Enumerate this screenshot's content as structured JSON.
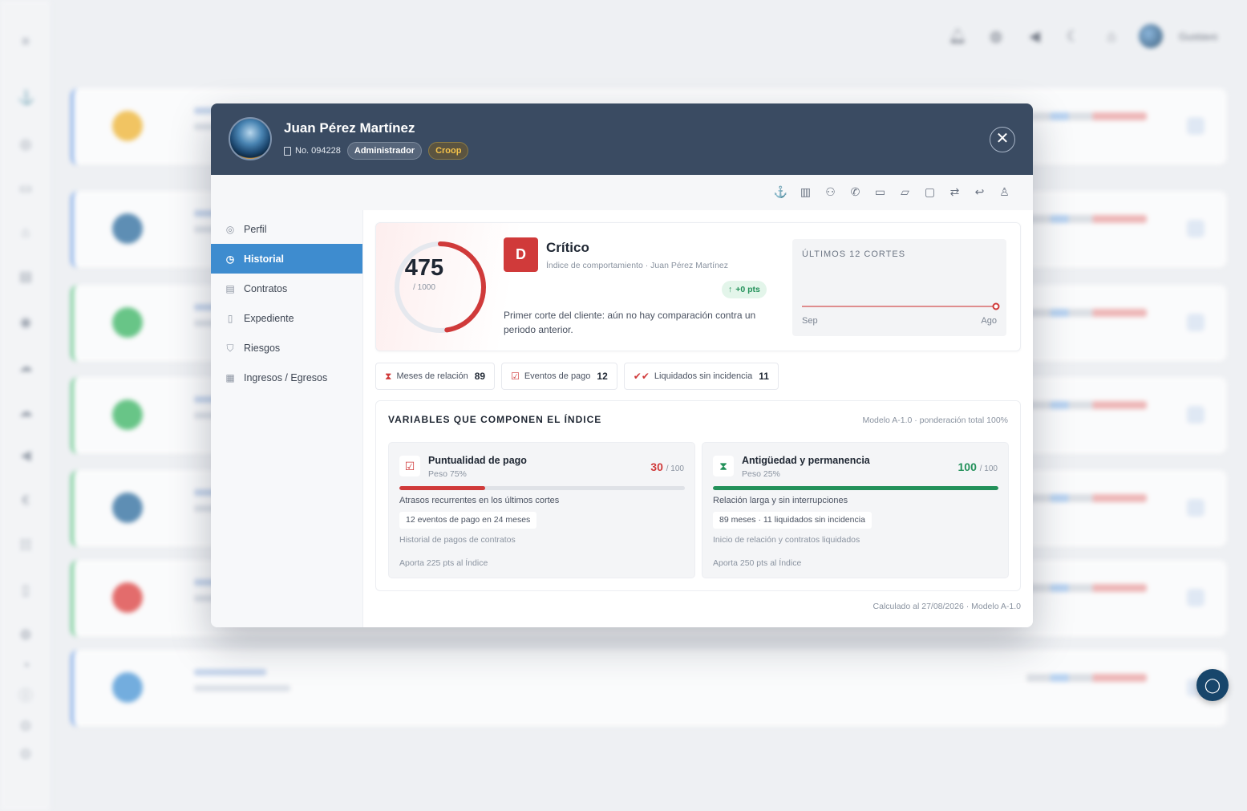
{
  "topbar": {
    "user_name": "Gustavo"
  },
  "modal": {
    "name": "Juan Pérez Martínez",
    "client_no": "No. 094228",
    "role_badge": "Administrador",
    "tier_badge": "Croop",
    "close_icon": "close-icon"
  },
  "toolbar": {
    "icons": [
      "stamp-icon",
      "barcode-icon",
      "user-icon",
      "phone-icon",
      "chat-icon",
      "note-icon",
      "wallet-icon",
      "transfer-icon",
      "reply-icon",
      "signature-icon"
    ]
  },
  "sidebar": {
    "items": [
      {
        "label": "Perfil",
        "icon": "user-circle-icon"
      },
      {
        "label": "Historial",
        "icon": "history-icon",
        "active": true
      },
      {
        "label": "Contratos",
        "icon": "document-icon"
      },
      {
        "label": "Expediente",
        "icon": "folder-icon"
      },
      {
        "label": "Riesgos",
        "icon": "shield-icon"
      },
      {
        "label": "Ingresos / Egresos",
        "icon": "cash-icon"
      }
    ]
  },
  "score": {
    "value": "475",
    "max_label": "/ 1000",
    "value_num": 475,
    "max_num": 1000,
    "grade": "D",
    "grade_label": "Crítico",
    "subtitle": "Índice de comportamiento · Juan Pérez Martínez",
    "delta": "+0 pts",
    "note": "Primer corte del cliente: aún no hay comparación contra un periodo anterior.",
    "accent_color": "#d03a3a"
  },
  "trend": {
    "title": "ÚLTIMOS 12 CORTES",
    "start_label": "Sep",
    "end_label": "Ago"
  },
  "chips": [
    {
      "label": "Meses de relación",
      "value": "89",
      "icon": "hourglass-icon"
    },
    {
      "label": "Eventos de pago",
      "value": "12",
      "icon": "calendar-check-icon"
    },
    {
      "label": "Liquidados sin incidencia",
      "value": "11",
      "icon": "double-check-icon"
    }
  ],
  "variables": {
    "title": "VARIABLES QUE COMPONEN EL ÍNDICE",
    "meta": "Modelo A-1.0 · ponderación total 100%",
    "items": [
      {
        "name": "Puntualidad de pago",
        "weight": "Peso 75%",
        "score": "30",
        "of": "/ 100",
        "fill_fraction": 0.3,
        "color": "#d03a3a",
        "description": "Atrasos recurrentes en los últimos cortes",
        "tag": "12 eventos de pago en 24 meses",
        "source": "Historial de pagos de contratos",
        "contribution": "Aporta 225 pts al Índice"
      },
      {
        "name": "Antigüedad y permanencia",
        "weight": "Peso 25%",
        "score": "100",
        "of": "/ 100",
        "fill_fraction": 1.0,
        "color": "#23915a",
        "description": "Relación larga y sin interrupciones",
        "tag": "89 meses · 11 liquidados sin incidencia",
        "source": "Inicio de relación y contratos liquidados",
        "contribution": "Aporta 250 pts al Índice"
      }
    ]
  },
  "footer": "Calculado al 27/08/2026 · Modelo A-1.0"
}
